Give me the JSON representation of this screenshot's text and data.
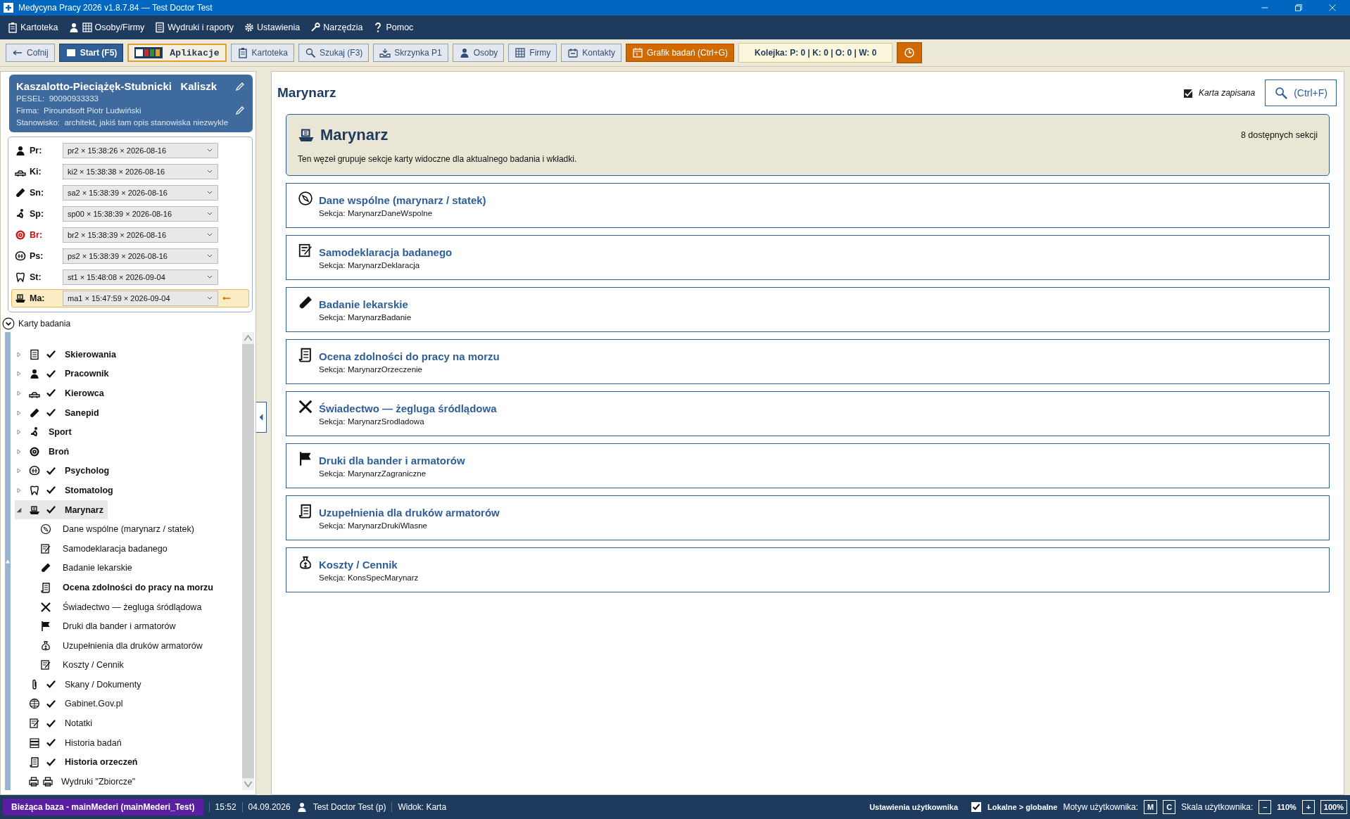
{
  "window": {
    "title": "Medycyna Pracy 2026 v1.8.7.84 — Test Doctor Test"
  },
  "menu": [
    {
      "label": "Kartoteka"
    },
    {
      "label": "Osoby/Firmy"
    },
    {
      "label": "Wydruki i raporty"
    },
    {
      "label": "Ustawienia"
    },
    {
      "label": "Narzędzia"
    },
    {
      "label": "Pomoc"
    }
  ],
  "toolbar": [
    {
      "kind": "nav",
      "label": "Cofnij"
    },
    {
      "kind": "primary",
      "label": "Start (F5)"
    },
    {
      "kind": "apps",
      "label": "Aplikacje"
    },
    {
      "kind": "plain",
      "label": "Kartoteka"
    },
    {
      "kind": "plain",
      "label": "Szukaj (F3)"
    },
    {
      "kind": "plain",
      "label": "Skrzynka P1"
    },
    {
      "kind": "plain",
      "label": "Osoby"
    },
    {
      "kind": "plain",
      "label": "Firmy"
    },
    {
      "kind": "plain",
      "label": "Kontakty"
    },
    {
      "kind": "accent",
      "label": "Grafik badań (Ctrl+G)"
    },
    {
      "kind": "info",
      "label": "Kolejka: P: 0 | K: 0 | O: 0 | W: 0"
    },
    {
      "kind": "clock"
    }
  ],
  "patient": {
    "surname": "Kaszalotto-Pieciążęk-Stubnicki",
    "first_name": "Kaliszk",
    "pesel_label": "PESEL:",
    "pesel": "90090933333",
    "company_label": "Firma:",
    "company": "Piroundsoft  Piotr Ludwiński",
    "position_label": "Stanowisko:",
    "position": "architekt, jakiś tam opis stanowiska niezwykle"
  },
  "exams": [
    {
      "code": "Pr:",
      "value": "pr2 × 15:38:26 × 2026-08-16",
      "alert": false,
      "selected": false
    },
    {
      "code": "Ki:",
      "value": "ki2 × 15:38:38 × 2026-08-16",
      "alert": false,
      "selected": false
    },
    {
      "code": "Sn:",
      "value": "sa2 × 15:38:39 × 2026-08-16",
      "alert": false,
      "selected": false
    },
    {
      "code": "Sp:",
      "value": "sp00 × 15:38:39 × 2026-08-16",
      "alert": false,
      "selected": false
    },
    {
      "code": "Br:",
      "value": "br2 × 15:38:39 × 2026-08-16",
      "alert": true,
      "selected": false
    },
    {
      "code": "Ps:",
      "value": "ps2 × 15:38:39 × 2026-08-16",
      "alert": false,
      "selected": false
    },
    {
      "code": "St:",
      "value": "st1 × 15:48:08 × 2026-09-04",
      "alert": false,
      "selected": false
    },
    {
      "code": "Ma:",
      "value": "ma1 × 15:47:59 × 2026-09-04",
      "alert": false,
      "selected": true
    }
  ],
  "tree": {
    "title": "Karty badania",
    "expanded": true,
    "items": [
      {
        "label": "Skierowania",
        "checked": true,
        "bold": true,
        "selected": false,
        "expanded": false
      },
      {
        "label": "Pracownik",
        "checked": true,
        "bold": true,
        "selected": false,
        "expanded": false
      },
      {
        "label": "Kierowca",
        "checked": true,
        "bold": true,
        "selected": false,
        "expanded": false
      },
      {
        "label": "Sanepid",
        "checked": true,
        "bold": true,
        "selected": false,
        "expanded": false
      },
      {
        "label": "Sport",
        "checked": false,
        "bold": true,
        "selected": false,
        "expanded": false
      },
      {
        "label": "Broń",
        "checked": false,
        "bold": true,
        "selected": false,
        "expanded": false
      },
      {
        "label": "Psycholog",
        "checked": true,
        "bold": true,
        "selected": false,
        "expanded": false
      },
      {
        "label": "Stomatolog",
        "checked": true,
        "bold": true,
        "selected": false,
        "expanded": false
      },
      {
        "label": "Marynarz",
        "checked": true,
        "bold": true,
        "selected": true,
        "expanded": true,
        "children": [
          {
            "label": "Dane wspólne (marynarz / statek)",
            "bold": false
          },
          {
            "label": "Samodeklaracja badanego",
            "bold": false
          },
          {
            "label": "Badanie lekarskie",
            "bold": false
          },
          {
            "label": "Ocena zdolności do pracy na morzu",
            "bold": true
          },
          {
            "label": "Świadectwo — żegluga śródlądowa",
            "bold": false
          },
          {
            "label": "Druki dla bander i armatorów",
            "bold": false
          },
          {
            "label": "Uzupełnienia dla druków armatorów",
            "bold": false
          },
          {
            "label": "Koszty / Cennik",
            "bold": false
          }
        ]
      },
      {
        "label": "Skany / Dokumenty",
        "checked": true,
        "bold": false,
        "selected": false
      },
      {
        "label": "Gabinet.Gov.pl",
        "checked": true,
        "bold": false,
        "selected": false
      },
      {
        "label": "Notatki",
        "checked": true,
        "bold": false,
        "selected": false
      },
      {
        "label": "Historia badań",
        "checked": true,
        "bold": false,
        "selected": false
      },
      {
        "label": "Historia orzeczeń",
        "checked": true,
        "bold": true,
        "selected": false
      },
      {
        "label": "Wydruki \"Zbiorcze\"",
        "checked": false,
        "bold": false,
        "selected": false
      }
    ]
  },
  "content": {
    "title": "Marynarz",
    "saved_label": "Karta zapisana",
    "saved": true,
    "search_button": "(Ctrl+F)",
    "banner": {
      "title": "Marynarz",
      "count": "8 dostępnych sekcji",
      "description": "Ten węzeł grupuje sekcje karty widoczne dla aktualnego badania i wkładki."
    },
    "sections": [
      {
        "title": "Dane wspólne (marynarz / statek)",
        "subtitle": "Sekcja: MarynarzDaneWspolne"
      },
      {
        "title": "Samodeklaracja badanego",
        "subtitle": "Sekcja: MarynarzDeklaracja"
      },
      {
        "title": "Badanie lekarskie",
        "subtitle": "Sekcja: MarynarzBadanie"
      },
      {
        "title": "Ocena zdolności do pracy na morzu",
        "subtitle": "Sekcja: MarynarzOrzeczenie"
      },
      {
        "title": "Świadectwo — żegluga śródlądowa",
        "subtitle": "Sekcja: MarynarzSrodladowa"
      },
      {
        "title": "Druki dla bander i armatorów",
        "subtitle": "Sekcja: MarynarzZagraniczne"
      },
      {
        "title": "Uzupełnienia dla druków armatorów",
        "subtitle": "Sekcja: MarynarzDrukiWlasne"
      },
      {
        "title": "Koszty / Cennik",
        "subtitle": "Sekcja: KonsSpecMarynarz"
      }
    ]
  },
  "status_bar": {
    "database": "Bieżąca baza - mainMederi (mainMederi_Test)",
    "time": "15:52",
    "date": "04.09.2026",
    "user": "Test Doctor Test (p)",
    "view": "Widok: Karta",
    "settings": "Ustawienia użytkownika",
    "local_label": "Lokalne > globalne",
    "local_checked": true,
    "theme_label": "Motyw użytkownika:",
    "theme_buttons": [
      "M",
      "C"
    ],
    "scale_label": "Skala użytkownika:",
    "scale_minus": "–",
    "scale_value": "110%",
    "scale_plus": "+",
    "scale_reset": "100%"
  }
}
